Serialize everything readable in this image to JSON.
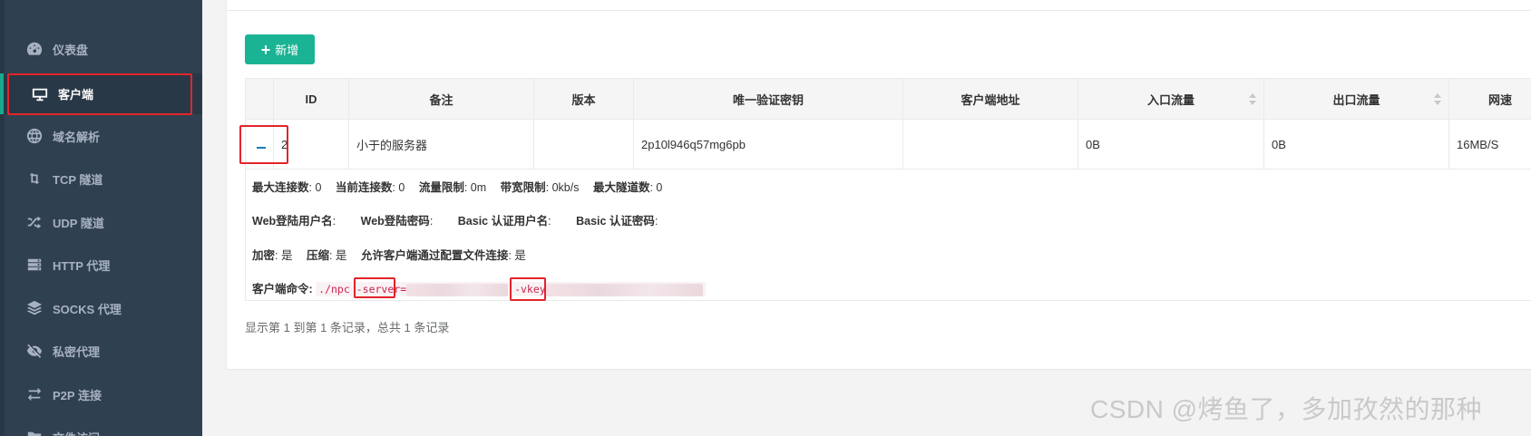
{
  "sidebar": {
    "items": [
      {
        "label": "仪表盘",
        "icon": "dashboard-icon"
      },
      {
        "label": "客户端",
        "icon": "monitor-icon",
        "active": true
      },
      {
        "label": "域名解析",
        "icon": "globe-icon"
      },
      {
        "label": "TCP 隧道",
        "icon": "retweet-icon"
      },
      {
        "label": "UDP 隧道",
        "icon": "random-icon"
      },
      {
        "label": "HTTP 代理",
        "icon": "server-icon"
      },
      {
        "label": "SOCKS 代理",
        "icon": "layers-icon"
      },
      {
        "label": "私密代理",
        "icon": "eye-slash-icon"
      },
      {
        "label": "P2P 连接",
        "icon": "exchange-icon"
      },
      {
        "label": "文件访问",
        "icon": "folder-icon"
      }
    ]
  },
  "toolbar": {
    "add_label": "新增"
  },
  "table": {
    "headers": [
      "",
      "ID",
      "备注",
      "版本",
      "唯一验证密钥",
      "客户端地址",
      "入口流量",
      "出口流量",
      "网速"
    ],
    "row": {
      "toggle": "−",
      "id": "2",
      "remark": "小于的服务器",
      "version": "",
      "vkey": "2p10l946q57mg6pb",
      "addr": "",
      "inflow": "0B",
      "outflow": "0B",
      "speed": "16MB/S"
    }
  },
  "detail": {
    "line1": [
      {
        "k": "最大连接数",
        "v": ": 0"
      },
      {
        "k": "当前连接数",
        "v": ": 0"
      },
      {
        "k": "流量限制",
        "v": ": 0m"
      },
      {
        "k": "带宽限制",
        "v": ": 0kb/s"
      },
      {
        "k": "最大隧道数",
        "v": ": 0"
      }
    ],
    "line2": [
      {
        "k": "Web登陆用户名",
        "v": ":"
      },
      {
        "k": "Web登陆密码",
        "v": ":"
      },
      {
        "k": "Basic 认证用户名",
        "v": ":"
      },
      {
        "k": "Basic 认证密码",
        "v": ":"
      }
    ],
    "line3": [
      {
        "k": "加密",
        "v": ": 是"
      },
      {
        "k": "压缩",
        "v": ": 是"
      },
      {
        "k": "允许客户端通过配置文件连接",
        "v": ": 是"
      }
    ],
    "cmd_label": "客户端命令:",
    "cmd_prefix": "./npc",
    "cmd_server": "-server",
    "cmd_eq": "=",
    "cmd_vkey": "-vkey"
  },
  "footer": {
    "records_text": "显示第 1 到第 1 条记录，总共 1 条记录"
  },
  "watermark": "CSDN @烤鱼了，多加孜然的那种"
}
